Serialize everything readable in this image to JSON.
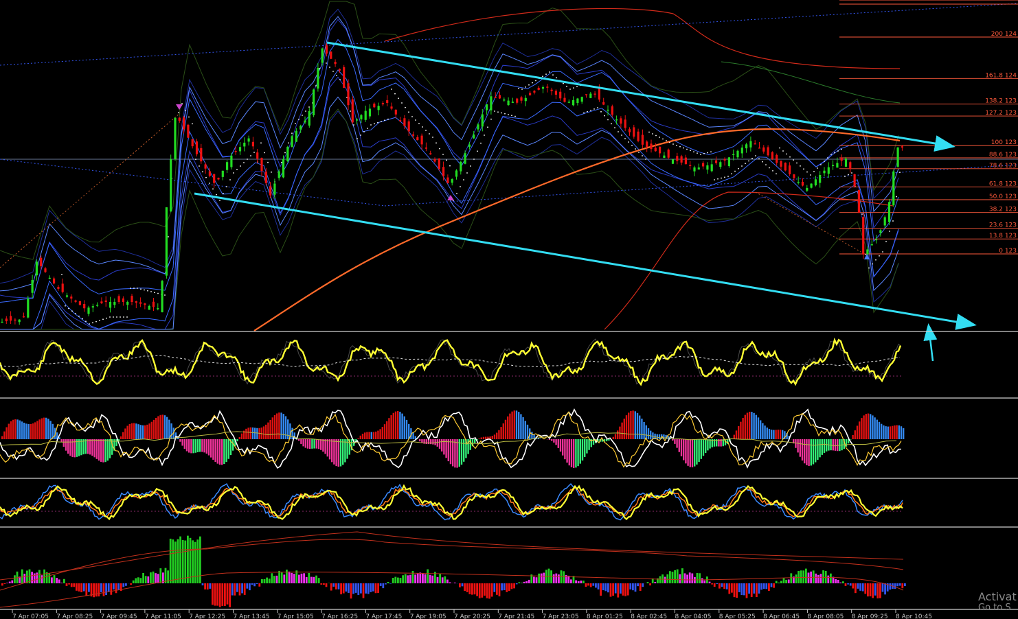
{
  "chart_data": {
    "type": "candlestick",
    "instrument_panel_labels": [],
    "time_axis": [
      "7 Apr 07:05",
      "7 Apr 08:25",
      "7 Apr 09:45",
      "7 Apr 11:05",
      "7 Apr 12:25",
      "7 Apr 13:45",
      "7 Apr 15:05",
      "7 Apr 16:25",
      "7 Apr 17:45",
      "7 Apr 19:05",
      "7 Apr 20:25",
      "7 Apr 21:45",
      "7 Apr 23:05",
      "8 Apr 01:25",
      "8 Apr 02:45",
      "8 Apr 04:05",
      "8 Apr 05:25",
      "8 Apr 06:45",
      "8 Apr 08:05",
      "8 Apr 09:25",
      "8 Apr 10:45"
    ],
    "fibonacci_levels": [
      {
        "label": "200 124",
        "level": 200
      },
      {
        "label": "161.8 124",
        "level": 161.8
      },
      {
        "label": "138.2 123",
        "level": 138.2
      },
      {
        "label": "127.2 123",
        "level": 127.2
      },
      {
        "label": "100 123",
        "level": 100
      },
      {
        "label": "88.6 123",
        "level": 88.6
      },
      {
        "label": "78.6 123",
        "level": 78.6
      },
      {
        "label": "61.8 123",
        "level": 61.8
      },
      {
        "label": "50.0 123",
        "level": 50.0
      },
      {
        "label": "38.2 123",
        "level": 38.2
      },
      {
        "label": "23.6 123",
        "level": 23.6
      },
      {
        "label": "13.8 123",
        "level": 13.8
      },
      {
        "label": "0 123",
        "level": 0
      }
    ],
    "colors": {
      "background": "#000000",
      "bull_candle": "#22dd22",
      "bear_candle": "#ee1111",
      "channel": "#33ddf2",
      "fib": "#ff5a3c",
      "oscillator": "#ffff33",
      "macd_red": "#dd1111",
      "macd_green": "#33ee77",
      "macd_blue": "#3388ee",
      "macd_pink": "#ee3399",
      "hist_green": "#22cc22",
      "hist_magenta": "#ee33ee",
      "hist_red": "#ee1111",
      "hist_blue": "#3355ee"
    }
  },
  "watermark": {
    "line1": "Activat",
    "line2": "Go to S"
  }
}
